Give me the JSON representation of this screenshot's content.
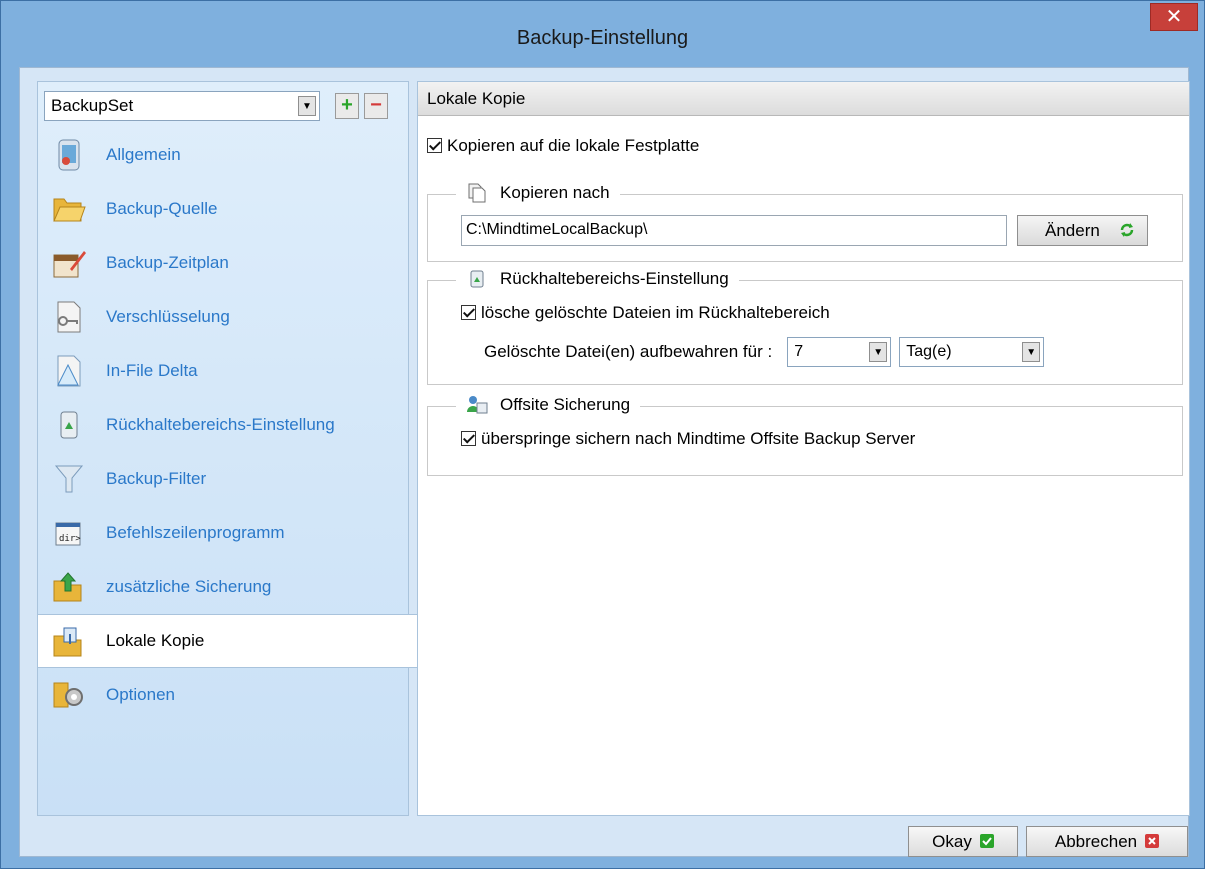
{
  "window": {
    "title": "Backup-Einstellung",
    "close_glyph": "✕"
  },
  "sidebar": {
    "backupset": {
      "value": "BackupSet",
      "arrow": "▼",
      "add": "+",
      "remove": "−"
    },
    "items": [
      {
        "label": "Allgemein",
        "icon": "general-icon"
      },
      {
        "label": "Backup-Quelle",
        "icon": "folder-icon"
      },
      {
        "label": "Backup-Zeitplan",
        "icon": "calendar-pen-icon"
      },
      {
        "label": "Verschlüsselung",
        "icon": "key-document-icon"
      },
      {
        "label": "In-File Delta",
        "icon": "delta-document-icon"
      },
      {
        "label": "Rückhaltebereichs-Einstellung",
        "icon": "recycle-bin-icon"
      },
      {
        "label": "Backup-Filter",
        "icon": "funnel-icon"
      },
      {
        "label": "Befehlszeilenprogramm",
        "icon": "command-line-icon"
      },
      {
        "label": "zusätzliche Sicherung",
        "icon": "extra-backup-icon"
      },
      {
        "label": "Lokale Kopie",
        "icon": "local-copy-icon",
        "active": true
      },
      {
        "label": "Optionen",
        "icon": "options-gear-icon"
      }
    ]
  },
  "panel": {
    "header": "Lokale Kopie",
    "copy_to_local": {
      "label": "Kopieren auf die lokale Festplatte",
      "checked": true
    },
    "copy_to": {
      "legend": "Kopieren nach",
      "path": "C:\\MindtimeLocalBackup\\",
      "change_label": "Ändern"
    },
    "retention": {
      "legend": "Rückhaltebereichs-Einstellung",
      "delete_label": "lösche gelöschte Dateien im Rückhaltebereich",
      "delete_checked": true,
      "keep_label": "Gelöschte Datei(en) aufbewahren für :",
      "keep_value": "7",
      "keep_unit": "Tag(e)",
      "arrow": "▼"
    },
    "offsite": {
      "legend": "Offsite Sicherung",
      "skip_label": "überspringe sichern nach Mindtime Offsite Backup Server",
      "skip_checked": true
    }
  },
  "footer": {
    "ok_label": "Okay",
    "cancel_label": "Abbrechen"
  },
  "colors": {
    "accent": "#2a78c9",
    "titlebar": "#7fb0de",
    "close": "#c7403a"
  }
}
